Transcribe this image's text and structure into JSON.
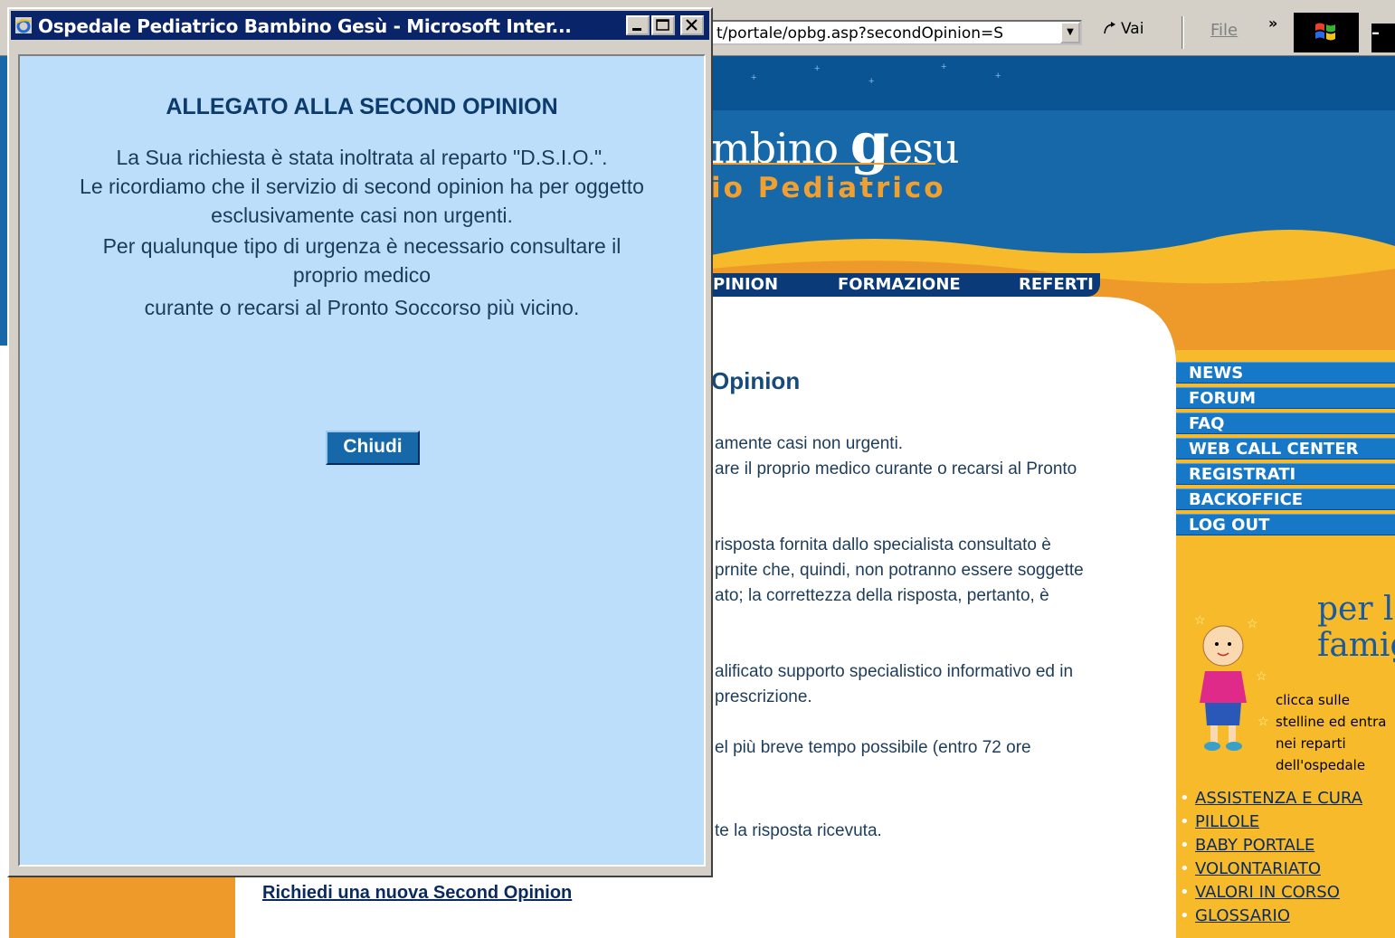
{
  "browser": {
    "address": "t/portale/opbg.asp?secondOpinion=S",
    "go_label": "Vai",
    "menu_file": "File",
    "chevron": "»"
  },
  "popup": {
    "title": "Ospedale Pediatrico Bambino Gesù - Microsoft Inter...",
    "heading": "ALLEGATO ALLA SECOND OPINION",
    "lines": [
      "La Sua richiesta è stata inoltrata al reparto \"D.S.I.O.\".",
      "Le ricordiamo che il servizio di second opinion ha per oggetto",
      "esclusivamente casi non urgenti.",
      "Per qualunque tipo di urgenza è necessario consultare il",
      "proprio medico",
      "curante o recarsi al Pronto Soccorso più vicino."
    ],
    "close_button": "Chiudi"
  },
  "site": {
    "logo_main_a": "mbino ",
    "logo_main_b": "g",
    "logo_main_c": "esu",
    "logo_sub": "io Pediatrico",
    "nav": [
      "PINION",
      "FORMAZIONE",
      "REFERTI"
    ],
    "content_title": "Opinion",
    "content_lines": [
      "amente casi non urgenti.",
      "are il proprio medico curante o recarsi al Pronto",
      "risposta fornita dallo specialista consultato è",
      "prnite che, quindi, non potranno essere soggette",
      "ato; la correttezza della risposta, pertanto, è",
      "alificato supporto specialistico informativo ed in",
      "prescrizione.",
      "el più breve tempo possibile (entro 72 ore",
      "te la risposta ricevuta."
    ],
    "side_menu": [
      "NEWS",
      "FORUM",
      "FAQ",
      "WEB CALL CENTER",
      "REGISTRATI",
      "BACKOFFICE",
      "LOG OUT"
    ],
    "family_title_1": "per la",
    "family_title_2": "famiglia",
    "family_text": [
      "clicca sulle",
      "stelline ed entra",
      "nei reparti",
      "dell'ospedale"
    ],
    "family_links": [
      "ASSISTENZA E CURA",
      "PILLOLE",
      "BABY PORTALE",
      "VOLONTARIATO",
      "VALORI IN CORSO",
      "GLOSSARIO"
    ],
    "bottom_link": "Richiedi una nuova Second Opinion"
  },
  "colors": {
    "popup_bg": "#bcdefa",
    "title_bar": "#0a246a",
    "site_blue": "#1668a8",
    "site_orange": "#f6ba2a"
  }
}
